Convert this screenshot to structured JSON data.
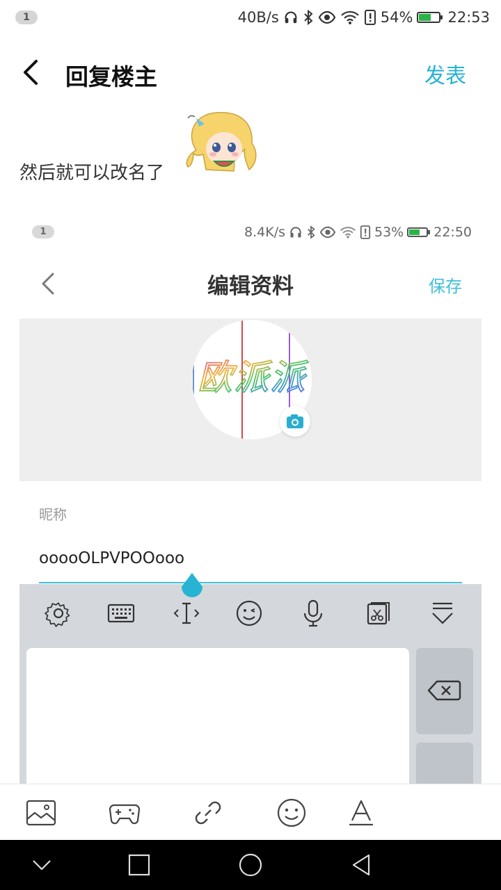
{
  "status_bar": {
    "notification_count": "1",
    "net_speed": "40B/s",
    "battery_percent": "54%",
    "time": "22:53",
    "icons": [
      "headphones-icon",
      "bluetooth-icon",
      "eye-icon",
      "wifi-icon",
      "sim-alert-icon",
      "battery-icon"
    ]
  },
  "header": {
    "back_icon": "chevron-left-icon",
    "title": "回复楼主",
    "publish_label": "发表"
  },
  "post": {
    "text": "然后就可以改名了",
    "sticker": "anime-girl-sticker"
  },
  "embedded_screenshot": {
    "status_bar": {
      "notification_count": "1",
      "net_speed": "8.4K/s",
      "battery_percent": "53%",
      "time": "22:50"
    },
    "header": {
      "title": "编辑资料",
      "save_label": "保存"
    },
    "avatar": {
      "text": "欧派派",
      "camera_icon": "camera-icon"
    },
    "nickname": {
      "label": "昵称",
      "value": "ooooOLPVPOOooo"
    },
    "keyboard_toolbar": [
      "gear-icon",
      "keyboard-icon",
      "cursor-icon",
      "emoji-icon",
      "microphone-icon",
      "clipboard-icon",
      "collapse-icon"
    ]
  },
  "compose_toolbar": [
    "image-icon",
    "gamepad-icon",
    "link-icon",
    "emoji-icon",
    "text-format-icon"
  ],
  "nav_bar": [
    "nav-down-icon",
    "nav-recents-icon",
    "nav-home-icon",
    "nav-back-icon"
  ],
  "colors": {
    "accent": "#27b3d3",
    "battery": "#2bb34a",
    "nav_bar": "#000000"
  }
}
